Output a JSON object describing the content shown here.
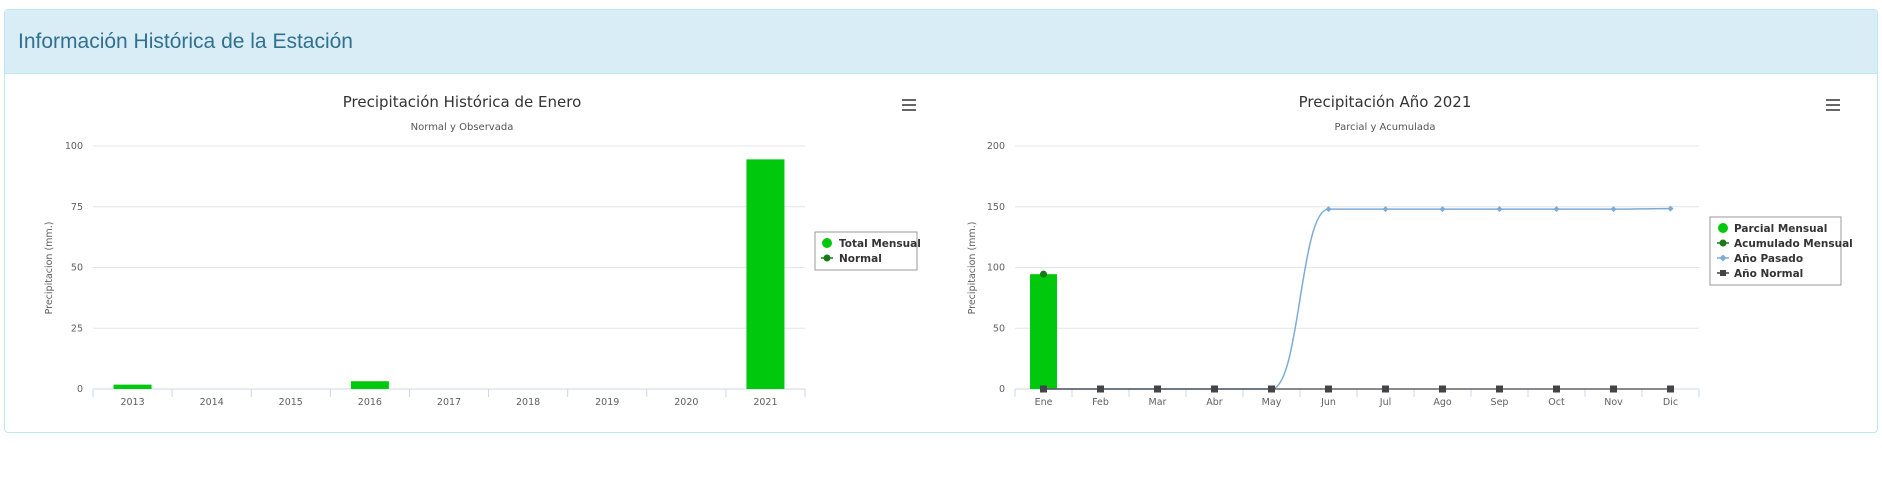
{
  "panel": {
    "title": "Información Histórica de la Estación"
  },
  "menu_icon": "hamburger-menu-icon",
  "colors": {
    "bar": "#00c90d",
    "normal": "#1a7a1a",
    "acum": "#1a7a1a",
    "pasado": "#7cacd6",
    "anormal": "#434348"
  },
  "chart_data": [
    {
      "type": "bar",
      "title": "Precipitación Histórica de Enero",
      "subtitle": "Normal y Observada",
      "ylabel": "Precipitacion (mm.)",
      "ylim": [
        0,
        100
      ],
      "yticks": [
        "0",
        "25",
        "50",
        "75",
        "100"
      ],
      "categories": [
        "2013",
        "2014",
        "2015",
        "2016",
        "2017",
        "2018",
        "2019",
        "2020",
        "2021"
      ],
      "series": [
        {
          "name": "Total Mensual",
          "type": "bar",
          "values": [
            1.8,
            0,
            0,
            3.2,
            0,
            0,
            0,
            0,
            94.5
          ]
        },
        {
          "name": "Normal",
          "type": "line",
          "values": []
        }
      ],
      "legend": "right"
    },
    {
      "type": "bar",
      "title": "Precipitación Año 2021",
      "subtitle": "Parcial y Acumulada",
      "ylabel": "Precipitacion (mm.)",
      "ylim": [
        0,
        200
      ],
      "yticks": [
        "0",
        "50",
        "100",
        "150",
        "200"
      ],
      "categories": [
        "Ene",
        "Feb",
        "Mar",
        "Abr",
        "May",
        "Jun",
        "Jul",
        "Ago",
        "Sep",
        "Oct",
        "Nov",
        "Dic"
      ],
      "series": [
        {
          "name": "Parcial Mensual",
          "type": "bar",
          "values": [
            94.5,
            null,
            null,
            null,
            null,
            null,
            null,
            null,
            null,
            null,
            null,
            null
          ]
        },
        {
          "name": "Acumulado Mensual",
          "type": "line",
          "values": [
            94.5,
            null,
            null,
            null,
            null,
            null,
            null,
            null,
            null,
            null,
            null,
            null
          ]
        },
        {
          "name": "Año Pasado",
          "type": "spline",
          "values": [
            0,
            0,
            0,
            0,
            0,
            148,
            148,
            148,
            148,
            148,
            148,
            148.5
          ]
        },
        {
          "name": "Año Normal",
          "type": "line",
          "values": [
            0,
            0,
            0,
            0,
            0,
            0,
            0,
            0,
            0,
            0,
            0,
            0
          ]
        }
      ],
      "legend": "right"
    }
  ]
}
